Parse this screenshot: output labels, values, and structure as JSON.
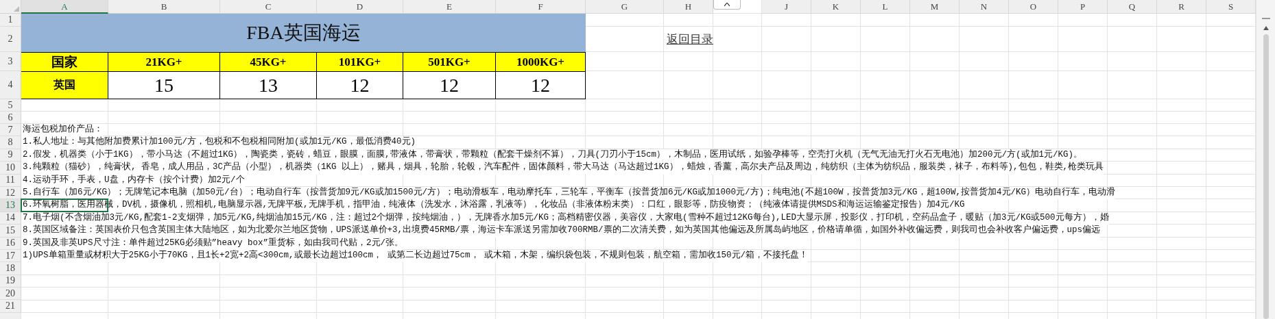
{
  "columns": [
    {
      "label": "A",
      "selected": true
    },
    {
      "label": "B",
      "selected": false
    },
    {
      "label": "C",
      "selected": false
    },
    {
      "label": "D",
      "selected": false
    },
    {
      "label": "E",
      "selected": false
    },
    {
      "label": "F",
      "selected": false
    },
    {
      "label": "G",
      "selected": false
    },
    {
      "label": "H",
      "selected": false
    },
    {
      "kind": "collapse"
    },
    {
      "label": "J",
      "selected": false
    },
    {
      "label": "K",
      "selected": false
    },
    {
      "label": "L",
      "selected": false
    },
    {
      "label": "M",
      "selected": false
    },
    {
      "label": "N",
      "selected": false
    },
    {
      "label": "O",
      "selected": false
    },
    {
      "label": "P",
      "selected": false
    },
    {
      "label": "Q",
      "selected": false
    },
    {
      "label": "R",
      "selected": false
    },
    {
      "label": "S",
      "selected": false
    }
  ],
  "row_headers": [
    {
      "label": "1",
      "selected": false
    },
    {
      "label": "2",
      "selected": false
    },
    {
      "label": "3",
      "selected": false
    },
    {
      "label": "4",
      "selected": false
    },
    {
      "label": "5",
      "selected": false
    },
    {
      "label": "6",
      "selected": false
    },
    {
      "label": "7",
      "selected": false
    },
    {
      "label": "8",
      "selected": false
    },
    {
      "label": "9",
      "selected": false
    },
    {
      "label": "10",
      "selected": false
    },
    {
      "label": "11",
      "selected": false
    },
    {
      "label": "12",
      "selected": false
    },
    {
      "label": "13",
      "selected": true
    },
    {
      "label": "14",
      "selected": false
    },
    {
      "label": "15",
      "selected": false
    },
    {
      "label": "16",
      "selected": false
    },
    {
      "label": "17",
      "selected": false
    },
    {
      "label": "18",
      "selected": false
    },
    {
      "label": "19",
      "selected": false
    },
    {
      "label": "20",
      "selected": false
    },
    {
      "label": "21",
      "selected": false
    }
  ],
  "title": "FBA英国海运",
  "link": "返回目录",
  "rate_table": {
    "header": [
      "国家",
      "21KG+",
      "45KG+",
      "101KG+",
      "501KG+",
      "1000KG+"
    ],
    "rows": [
      [
        "英国",
        "15",
        "13",
        "12",
        "12",
        "12"
      ]
    ]
  },
  "notes": [
    "海运包税加价产品：",
    "1.私人地址：与其他附加费累计加100元/方，包税和不包税相同附加(或加1元/KG，最低消费40元)",
    "2.假发，机器类（小于1KG），带小马达（不超过1KG），陶瓷类，瓷砖，蜡豆，眼膜，面膜,带液体，带膏状，带颗粒（配套干燥剂不算），刀具(刀刃小于15cm），木制品，医用试纸，如验孕棒等，空壳打火机（无气无油无打火石无电池）加200元/方(或加1元/KG)。",
    "3.纯颗粒（猫砂），纯膏状, 香皂，成人用品，3C产品（小型），机器类（1KG 以上），赌具，烟具，轮胎，轮毂，汽车配件，固体颜料，带大马达（马达超过1KG），蜡烛，香薰，高尔夫产品及周边，纯纺织（主体为纺织品，服装类，袜子，布料等),包包，鞋类,枪类玩具",
    "4.运动手环，手表，U盘，内存卡（按个计费）加2元/个",
    "5.自行车（加6元/KG）；无牌笔记本电脑（加50元/台）；电动自行车（按普货加9元/KG或加1500元/方）；电动滑板车，电动摩托车，三轮车，平衡车（按普货加6元/KG或加1000元/方)；纯电池(不超100W，按普货加3元/KG，超100W,按普货加4元/KG）电动自行车，电动滑",
    "6.环氧树脂，医用器械，DV机，摄像机，照相机,电脑显示器,无牌平板,无牌手机，指甲油，纯液体（洗发水，沐浴露，乳液等），化妆品（非液体粉末类）：口红，眼影等，防疫物资；（纯液体请提供MSDS和海运运输鉴定报告）加4元/KG",
    "7.电子烟(不含烟油加3元/KG,配套1-2支烟弹，加5元/KG,纯烟油加15元/KG，注：超过2个烟弹，按纯烟油，），无牌香水加5元/KG；高档精密仪器，美容仪，大家电(雪种不超过12KG每台),LED大显示屏，投影仪，打印机，空药品盒子，暖贴（加3元/KG或500元每方），婚",
    "8.英国区域备注：英国表价只包含英国主体大陆地区，如为北爱尔兰地区货物，UPS派送单价+3,出境费45RMB/票，海运卡车派送另需加收700RMB/票的二次清关费，如为英国其他偏远及所属岛屿地区，价格请单循，如国外补收偏远费，则我司也会补收客户偏远费，ups偏远",
    "9.英国及非英UPS尺寸注：单件超过25KG必须贴”heavy box”重货标，如由我司代贴，2元/张。",
    "1)UPS单箱重量或材积大于25KG小于70KG，且1长+2宽+2高<300cm,或最长边超过100cm， 或第二长边超过75cm， 或木箱，木架，编织袋包装，不规则包装，航空箱，需加收150元/箱，不接托盘！"
  ]
}
